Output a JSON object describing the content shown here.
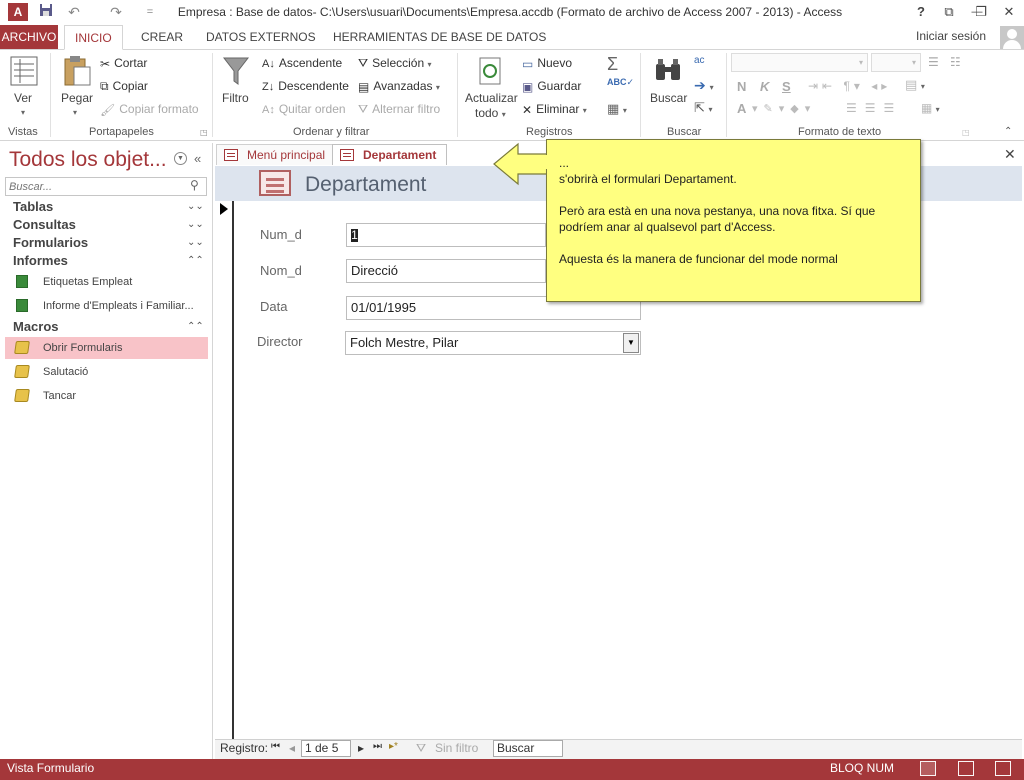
{
  "window": {
    "title": "Empresa : Base de datos- C:\\Users\\usuari\\Documents\\Empresa.accdb (Formato de archivo de Access 2007 - 2013) - Access",
    "help": "?",
    "restore_ribbon": "⧉",
    "minimize": "—",
    "maximize": "❐",
    "close": "✕"
  },
  "quick_access": {
    "app_icon": "A",
    "undo": "↶",
    "redo": "↷",
    "customize": "="
  },
  "ribbon_tabs": {
    "file": "ARCHIVO",
    "inicio": "INICIO",
    "crear": "CREAR",
    "datos_externos": "DATOS EXTERNOS",
    "herramientas": "HERRAMIENTAS DE BASE DE DATOS",
    "signin": "Iniciar sesión"
  },
  "ribbon": {
    "vistas": {
      "label": "Vistas",
      "ver": "Ver"
    },
    "portapapeles": {
      "label": "Portapapeles",
      "pegar": "Pegar",
      "cortar": "Cortar",
      "copiar": "Copiar",
      "copiar_formato": "Copiar formato"
    },
    "ordenar": {
      "label": "Ordenar y filtrar",
      "filtro": "Filtro",
      "ascendente": "Ascendente",
      "descendente": "Descendente",
      "quitar_orden": "Quitar orden",
      "seleccion": "Selección",
      "avanzadas": "Avanzadas",
      "alternar_filtro": "Alternar filtro"
    },
    "registros": {
      "label": "Registros",
      "actualizar": "Actualizar",
      "todo": "todo",
      "nuevo": "Nuevo",
      "guardar": "Guardar",
      "eliminar": "Eliminar"
    },
    "buscar": {
      "label": "Buscar",
      "buscar": "Buscar"
    },
    "formato": {
      "label": "Formato de texto",
      "bold": "N",
      "italic": "K",
      "underline": "S",
      "font_color": "A"
    }
  },
  "nav_pane": {
    "title": "Todos los objet...",
    "search_placeholder": "Buscar...",
    "groups": {
      "tablas": "Tablas",
      "consultas": "Consultas",
      "formularios": "Formularios",
      "informes": "Informes",
      "macros": "Macros"
    },
    "informes": [
      "Etiquetas Empleat",
      "Informe d'Empleats i Familiar..."
    ],
    "macros": [
      "Obrir Formularis",
      "Salutació",
      "Tancar"
    ]
  },
  "doc_tabs": {
    "menu": "Menú principal",
    "dept": "Departament",
    "close": "✕"
  },
  "form": {
    "title": "Departament",
    "fields": {
      "num_label": "Num_d",
      "num_value": "1",
      "nom_label": "Nom_d",
      "nom_value": "Direcció",
      "data_label": "Data",
      "data_value": "01/01/1995",
      "director_label": "Director",
      "director_value": "Folch Mestre, Pilar"
    }
  },
  "callout": {
    "dots": "...",
    "line1": "s'obrirà el formulari Departament.",
    "line2": "Però ara està en una nova pestanya, una nova fitxa. Sí que podríem anar al qualsevol part d'Access.",
    "line3": "Aquesta és la manera de funcionar del mode normal"
  },
  "record_nav": {
    "label": "Registro:",
    "first": "⏮",
    "prev": "◂",
    "position": "1 de 5",
    "next": "▸",
    "last": "⏭",
    "new": "▸*",
    "no_filter": "Sin filtro",
    "search": "Buscar"
  },
  "status": {
    "left": "Vista Formulario",
    "numlock": "BLOQ NUM"
  },
  "colors": {
    "accent": "#a4373a",
    "callout": "#ffff80",
    "nav_selected": "#f8c3c8"
  }
}
